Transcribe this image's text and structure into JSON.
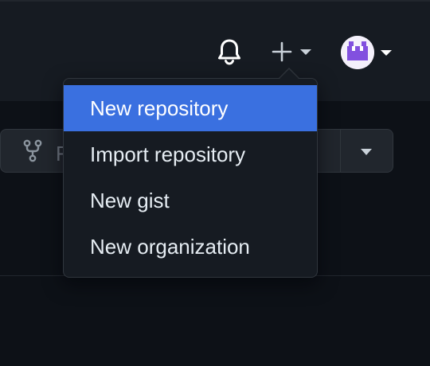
{
  "header": {
    "notifications_icon": "bell-icon",
    "create_icon": "plus-icon",
    "create_caret_icon": "caret-down-icon",
    "avatar_caret_icon": "caret-down-icon",
    "avatar_icon": "avatar-identicon"
  },
  "repo_actions": {
    "fork_icon": "repo-forked-icon",
    "fork_label_visible": "F",
    "fork_caret_icon": "caret-down-icon"
  },
  "create_menu": {
    "items": [
      {
        "label": "New repository",
        "active": true
      },
      {
        "label": "Import repository",
        "active": false
      },
      {
        "label": "New gist",
        "active": false
      },
      {
        "label": "New organization",
        "active": false
      }
    ]
  },
  "colors": {
    "background": "#0d1117",
    "header_background": "#161b22",
    "menu_background": "#161b22",
    "menu_border": "#30363d",
    "active_item": "#3a70e0",
    "text": "#e6edf3",
    "avatar_accent": "#8250df"
  }
}
